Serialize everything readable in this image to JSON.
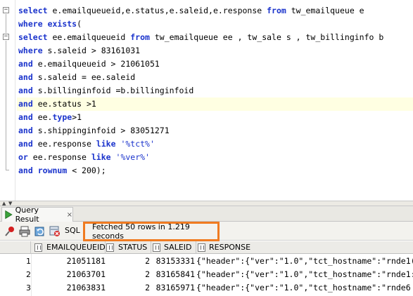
{
  "editor": {
    "lines": [
      [
        {
          "t": "select",
          "c": "kw"
        },
        {
          "t": " e.emailqueueid,e.status,e.saleid,e.response ",
          "c": ""
        },
        {
          "t": "from",
          "c": "kw"
        },
        {
          "t": " tw_emailqueue e",
          "c": ""
        }
      ],
      [
        {
          "t": "where",
          "c": "kw"
        },
        {
          "t": " ",
          "c": ""
        },
        {
          "t": "exists",
          "c": "kw"
        },
        {
          "t": "(",
          "c": ""
        }
      ],
      [
        {
          "t": "select",
          "c": "kw"
        },
        {
          "t": " ee.emailqueueid ",
          "c": ""
        },
        {
          "t": "from",
          "c": "kw"
        },
        {
          "t": " tw_emailqueue ee , tw_sale s , tw_billinginfo b",
          "c": ""
        }
      ],
      [
        {
          "t": "where",
          "c": "kw"
        },
        {
          "t": " s.saleid > 83161031",
          "c": ""
        }
      ],
      [
        {
          "t": "and",
          "c": "kw"
        },
        {
          "t": " e.emailqueueid > 21061051",
          "c": ""
        }
      ],
      [
        {
          "t": "and",
          "c": "kw"
        },
        {
          "t": " s.saleid = ee.saleid",
          "c": ""
        }
      ],
      [
        {
          "t": "and",
          "c": "kw"
        },
        {
          "t": " s.billinginfoid =b.billinginfoid",
          "c": ""
        }
      ],
      [
        {
          "t": "and",
          "c": "kw"
        },
        {
          "t": " ee.status >1",
          "c": ""
        }
      ],
      [
        {
          "t": "and",
          "c": "kw"
        },
        {
          "t": " ee.",
          "c": ""
        },
        {
          "t": "type",
          "c": "kw"
        },
        {
          "t": ">1",
          "c": ""
        }
      ],
      [
        {
          "t": "and",
          "c": "kw"
        },
        {
          "t": " s.shippinginfoid > 83051271",
          "c": ""
        }
      ],
      [
        {
          "t": "and",
          "c": "kw"
        },
        {
          "t": " ee.response ",
          "c": ""
        },
        {
          "t": "like",
          "c": "kw"
        },
        {
          "t": " ",
          "c": ""
        },
        {
          "t": "'%tct%'",
          "c": "str"
        }
      ],
      [
        {
          "t": "or",
          "c": "kw"
        },
        {
          "t": " ee.response ",
          "c": ""
        },
        {
          "t": "like",
          "c": "kw"
        },
        {
          "t": " ",
          "c": ""
        },
        {
          "t": "'%ver%'",
          "c": "str"
        }
      ],
      [
        {
          "t": "and",
          "c": "kw"
        },
        {
          "t": " ",
          "c": ""
        },
        {
          "t": "rownum",
          "c": "kw"
        },
        {
          "t": " < 200);",
          "c": ""
        }
      ]
    ],
    "highlighted_line": 7
  },
  "results_tab": {
    "label": "Query Result",
    "close": "×"
  },
  "toolbar": {
    "sql_label": "SQL",
    "status": "Fetched 50 rows in 1.219 seconds",
    "highlight_color": "#f07b21"
  },
  "grid": {
    "columns": [
      "EMAILQUEUEID",
      "STATUS",
      "SALEID",
      "RESPONSE"
    ],
    "rows": [
      {
        "n": "1",
        "emailqueueid": "21051181",
        "status": "2",
        "saleid": "83153331",
        "response": "{\"header\":{\"ver\":\"1.0\",\"tct_hostname\":\"rnde1("
      },
      {
        "n": "2",
        "emailqueueid": "21063701",
        "status": "2",
        "saleid": "83165841",
        "response": "{\"header\":{\"ver\":\"1.0\",\"tct_hostname\":\"rnde1:"
      },
      {
        "n": "3",
        "emailqueueid": "21063831",
        "status": "2",
        "saleid": "83165971",
        "response": "{\"header\":{\"ver\":\"1.0\",\"tct_hostname\":\"rnde6"
      }
    ]
  }
}
